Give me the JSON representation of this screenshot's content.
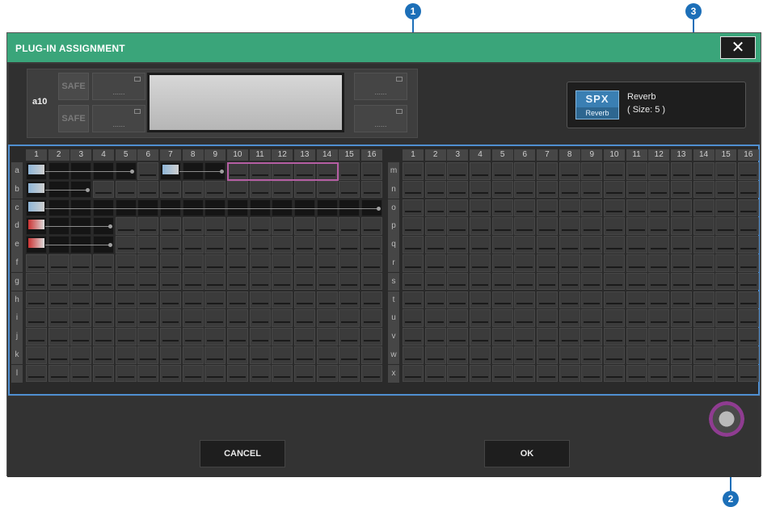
{
  "window": {
    "title": "PLUG-IN ASSIGNMENT",
    "close_label": "✕",
    "accent": "#3aa57a"
  },
  "rack": {
    "id_label": "a10",
    "safe_top": "SAFE",
    "safe_bottom": "SAFE",
    "slot_placeholder": "......"
  },
  "plugin_info": {
    "logo_top": "SPX",
    "logo_bottom": "Reverb",
    "name": "Reverb",
    "size": "( Size: 5 )"
  },
  "grid": {
    "left_columns": [
      "1",
      "2",
      "3",
      "4",
      "5",
      "6",
      "7",
      "8",
      "9",
      "10",
      "11",
      "12",
      "13",
      "14",
      "15",
      "16"
    ],
    "right_columns": [
      "1",
      "2",
      "3",
      "4",
      "5",
      "6",
      "7",
      "8",
      "9",
      "10",
      "11",
      "12",
      "13",
      "14",
      "15",
      "16"
    ],
    "left_rows": [
      "a",
      "b",
      "c",
      "d",
      "e",
      "f",
      "g",
      "h",
      "i",
      "j",
      "k",
      "l"
    ],
    "right_rows": [
      "m",
      "n",
      "o",
      "p",
      "q",
      "r",
      "s",
      "t",
      "u",
      "v",
      "w",
      "x"
    ]
  },
  "buttons": {
    "cancel": "CANCEL",
    "ok": "OK"
  },
  "callouts": [
    "1",
    "2",
    "3"
  ]
}
